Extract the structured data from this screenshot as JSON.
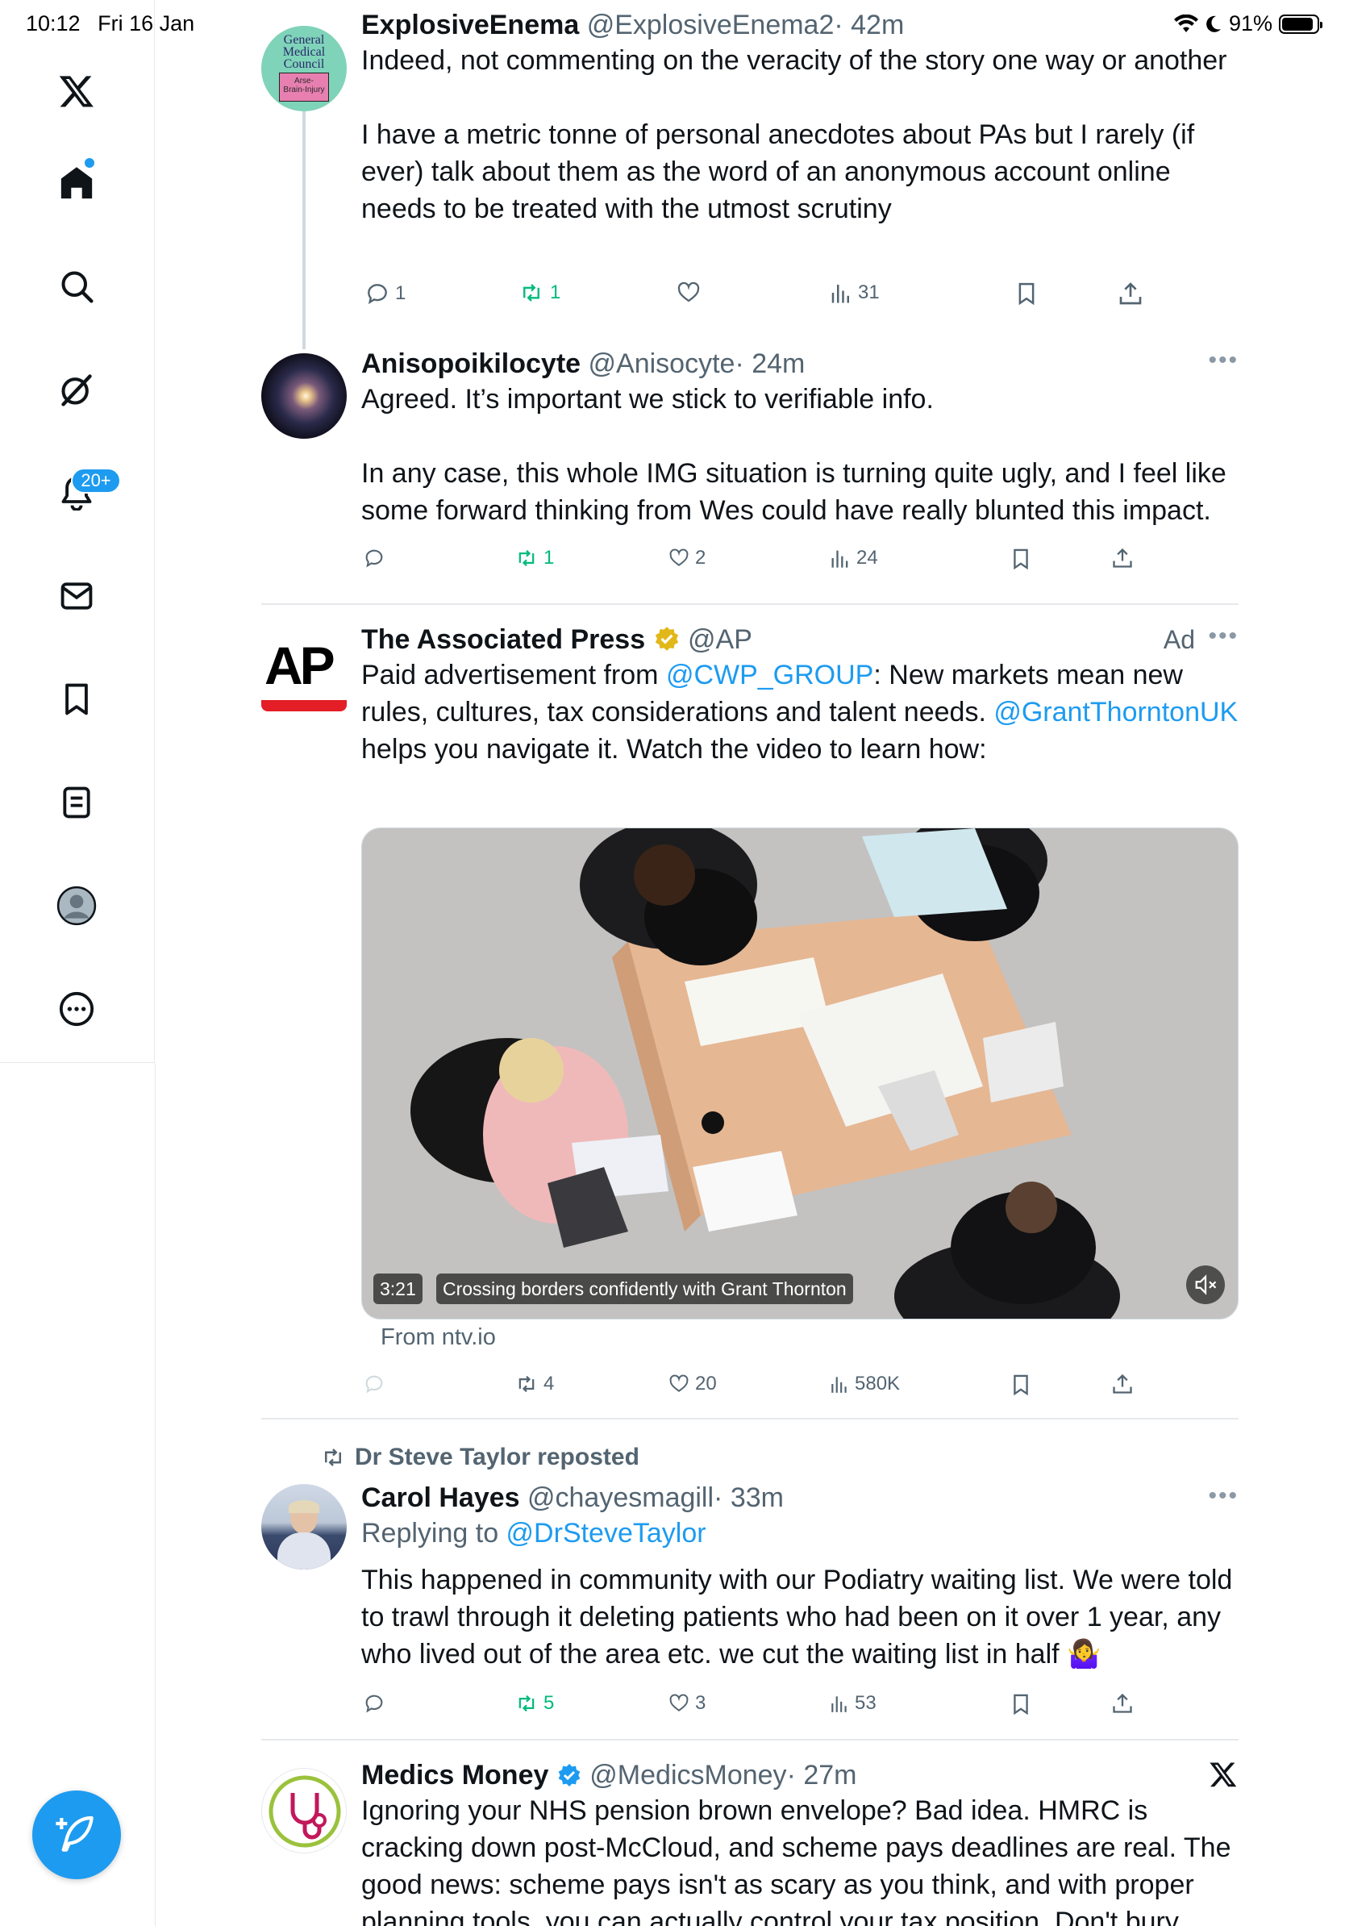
{
  "status": {
    "time": "10:12",
    "date": "Fri 16 Jan",
    "battery": "91%",
    "battery_level": 0.91
  },
  "sidebar": {
    "items": [
      {
        "name": "x-logo"
      },
      {
        "name": "home"
      },
      {
        "name": "explore"
      },
      {
        "name": "grok"
      },
      {
        "name": "notifications",
        "badge": "20+"
      },
      {
        "name": "messages"
      },
      {
        "name": "bookmarks"
      },
      {
        "name": "lists"
      },
      {
        "name": "profile"
      },
      {
        "name": "more"
      }
    ],
    "compose_icon": "feather-plus-icon"
  },
  "tweets": [
    {
      "name": "ExplosiveEnema",
      "handle": "@ExplosiveEnema2",
      "time": "· 42m",
      "avatar_text": [
        "General",
        "Medical",
        "Council",
        "Arse-",
        "Brain-Injury"
      ],
      "text_1": "Indeed, not commenting on the veracity of the story one way or another",
      "text_2": "I have a metric tonne of personal anecdotes about PAs but I rarely (if ever) talk about them as the word of an anonymous account online needs to be treated with the utmost scrutiny",
      "replies": "1",
      "reposts": "1",
      "likes": "",
      "views": "31"
    },
    {
      "name": "Anisopoikilocyte",
      "handle": "@Anisocyte",
      "time": "· 24m",
      "text_1": "Agreed. It’s important we stick to verifiable info.",
      "text_2": "In any case, this whole IMG situation is turning quite ugly, and I feel like some forward thinking from Wes could have really blunted this impact.",
      "replies": "",
      "reposts": "1",
      "likes": "2",
      "views": "24"
    },
    {
      "name": "The Associated Press",
      "handle": "@AP",
      "ad_label": "Ad",
      "avatar_text": "AP",
      "text_pre": "Paid advertisement from ",
      "mention_1": "@CWP_GROUP",
      "text_mid": ": New markets mean new rules, cultures, tax considerations and talent needs. ",
      "mention_2": "@GrantThorntonUK",
      "text_post": " helps you navigate it. Watch the video to learn how:",
      "video_duration": "3:21",
      "video_caption": "Crossing borders confidently with Grant Thornton",
      "source": "From ntv.io",
      "replies": "",
      "reposts": "4",
      "likes": "20",
      "views": "580K"
    },
    {
      "repost_by": "Dr Steve Taylor reposted",
      "name": "Carol Hayes",
      "handle": "@chayesmagill",
      "time": "· 33m",
      "replying_prefix": "Replying to ",
      "replying_to": "@DrSteveTaylor",
      "text": "This happened in community with our Podiatry waiting list. We were told to trawl through it deleting patients who had been on it over 1 year, any who lived out of the area etc. we cut the waiting list in half 🤷‍♀️",
      "replies": "",
      "reposts": "5",
      "likes": "3",
      "views": "53"
    },
    {
      "name": "Medics Money",
      "handle": "@MedicsMoney",
      "time": "· 27m",
      "text": "Ignoring your NHS pension brown envelope? Bad idea. HMRC is cracking down post-McCloud, and scheme pays deadlines are real. The good news: scheme pays isn't as scary as you think, and with proper planning tools, you can actually control your tax position. Don't bury"
    }
  ],
  "colors": {
    "accent": "#1d9bf0",
    "repost_green": "#00ba7c",
    "secondary_text": "#536471",
    "ap_red": "#e31e26",
    "verified_gold": "#e2b719"
  }
}
